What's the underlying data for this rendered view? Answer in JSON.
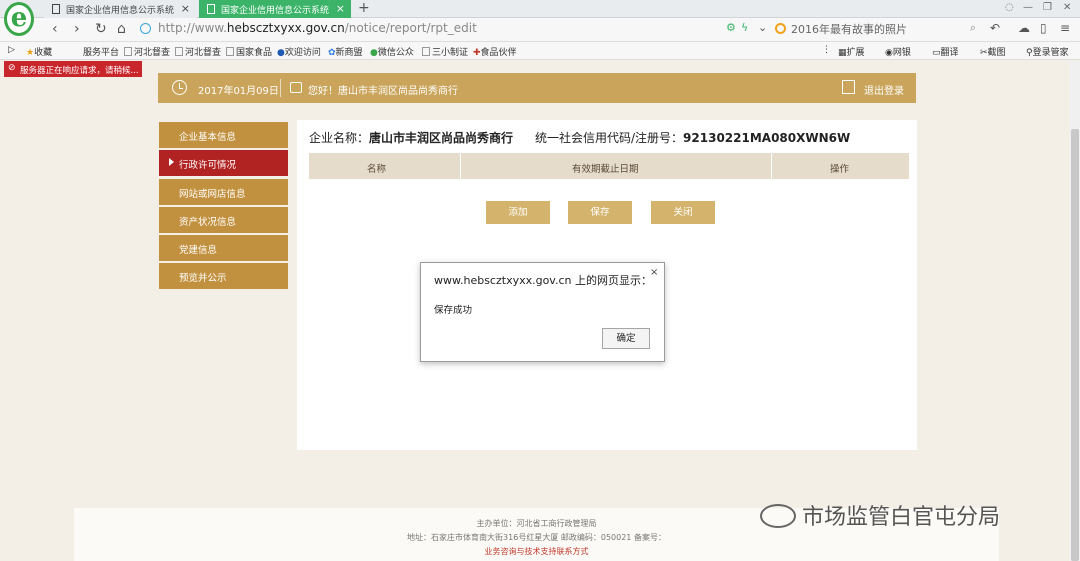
{
  "browser": {
    "tabs": [
      {
        "label": "国家企业信用信息公示系统",
        "active": false
      },
      {
        "label": "国家企业信用信息公示系统",
        "active": true
      }
    ],
    "new_tab": "+",
    "close_glyph": "×",
    "url_scheme": "http://www.",
    "url_domain": "hebscztxyxx.gov.cn",
    "url_path": "/notice/report/rpt_edit",
    "search_text": "2016年最有故事的照片",
    "bookmarks": [
      "收藏",
      "服务平台",
      "河北督查",
      "河北督查",
      "国家食品",
      "欢迎访问",
      "新商盟",
      "微信公众",
      "三小制证",
      "食品伙伴"
    ],
    "right_tools": [
      "扩展",
      "网银",
      "翻译",
      "截图",
      "登录管家"
    ],
    "status_banner": "服务器正在响应请求，请稍候..."
  },
  "header": {
    "date": "2017年01月09日",
    "greeting": "您好！唐山市丰润区尚品尚秀商行",
    "logout": "退出登录"
  },
  "sidebar": {
    "items": [
      {
        "label": "企业基本信息",
        "active": false
      },
      {
        "label": "行政许可情况",
        "active": true
      },
      {
        "label": "网站或网店信息",
        "active": false
      },
      {
        "label": "资产状况信息",
        "active": false
      },
      {
        "label": "党建信息",
        "active": false
      },
      {
        "label": "预览并公示",
        "active": false
      }
    ]
  },
  "main": {
    "company_label": "企业名称：",
    "company_name": "唐山市丰润区尚品尚秀商行",
    "credit_label": "统一社会信用代码/注册号：",
    "credit_code": "92130221MA080XWN6W",
    "table_headers": [
      "名称",
      "有效期截止日期",
      "操作"
    ],
    "buttons": {
      "add": "添加",
      "save": "保存",
      "close": "关闭"
    }
  },
  "dialog": {
    "title": "www.hebscztxyxx.gov.cn 上的网页显示：",
    "message": "保存成功",
    "ok": "确定",
    "close": "×"
  },
  "footer": {
    "line1": "主办单位：河北省工商行政管理局",
    "line2": "地址：石家庄市体育南大街316号红星大厦 邮政编码：050021 备案号：",
    "line3": "业务咨询与技术支持联系方式"
  },
  "watermark": "市场监管白官屯分局",
  "colors": {
    "gold": "#c9a45a",
    "sidebar": "#c2913f",
    "sidebar_active": "#b12323",
    "button": "#d4b46c",
    "tab_active": "#3bb469"
  }
}
